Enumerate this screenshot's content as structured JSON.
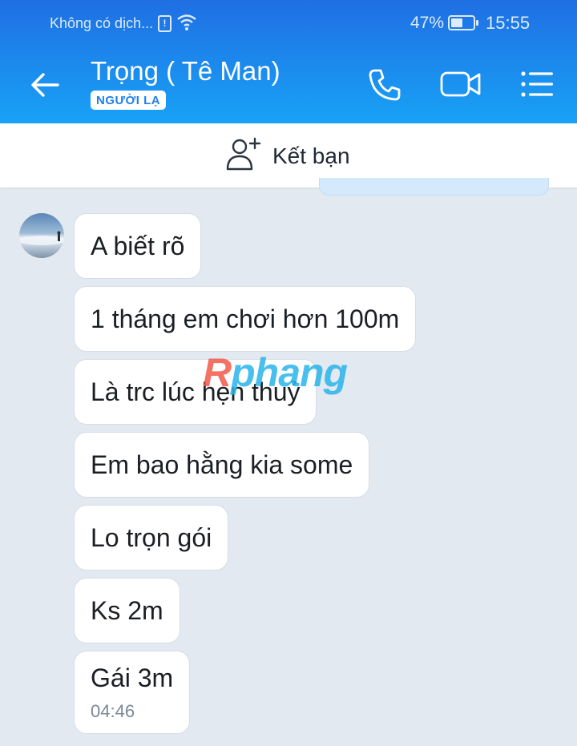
{
  "status_bar": {
    "carrier": "Không có dịch...",
    "battery_percent": "47%",
    "battery_level": 0.47,
    "time": "15:55"
  },
  "header": {
    "contact_name": "Trọng ( Tê Man)",
    "badge": "NGƯỜI LẠ",
    "icons": [
      "back-arrow-icon",
      "phone-icon",
      "video-call-icon",
      "menu-list-icon"
    ]
  },
  "add_friend": {
    "label": "Kết bạn",
    "icon": "add-user-icon"
  },
  "messages": [
    {
      "text": "A biết rõ"
    },
    {
      "text": "1 tháng em chơi hơn 100m"
    },
    {
      "text": "Là trc lúc hẹn thuỷ"
    },
    {
      "text": "Em bao hằng kia some"
    },
    {
      "text": "Lo trọn gói"
    },
    {
      "text": "Ks 2m"
    },
    {
      "text": "Gái 3m",
      "time": "04:46"
    }
  ],
  "watermark": {
    "first": "R",
    "rest": "phang"
  },
  "colors": {
    "header_top": "#1f6fe3",
    "header_bottom": "#18a2f5",
    "chat_background": "#e2e9f1",
    "bubble": "#ffffff"
  }
}
